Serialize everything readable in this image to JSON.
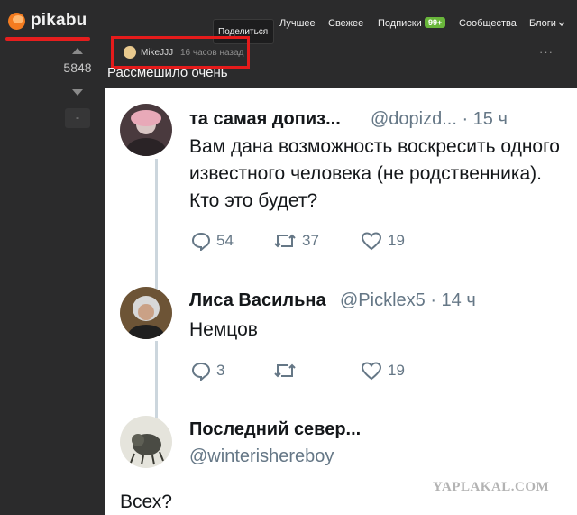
{
  "header": {
    "logo_text": "pikabu",
    "share_tooltip": "Поделиться",
    "nav": [
      "Лучшее",
      "Свежее",
      "Подписки",
      "Сообщества",
      "Блоги"
    ],
    "subscriptions_badge": "99+",
    "blogs_chevron": "chevron-down-icon"
  },
  "post": {
    "rating": "5848",
    "minus_label": "-",
    "author": "MikeJJJ",
    "time_ago": "16 часов назад",
    "more": "···",
    "title": "Рассмешило очень"
  },
  "tweets": [
    {
      "name": "та самая допиз...",
      "handle": "@dopizd... · 15 ч",
      "text": "Вам дана возможность воскресить одного известного человека (не родственника). Кто это будет?",
      "replies": "54",
      "retweets": "37",
      "likes": "19"
    },
    {
      "name": "Лиса Васильна",
      "handle": "@Picklex5 · 14 ч",
      "text": "Немцов",
      "replies": "3",
      "retweets": "",
      "likes": "19"
    },
    {
      "name": "Последний север...",
      "handle": "@winterishereboy",
      "text": "Всех?"
    }
  ],
  "watermark": "YAPLAKAL.COM",
  "colors": {
    "accent_red": "#e51b1b",
    "badge_green": "#69b63b",
    "logo_orange": "#f47c20",
    "twitter_gray": "#657786"
  }
}
